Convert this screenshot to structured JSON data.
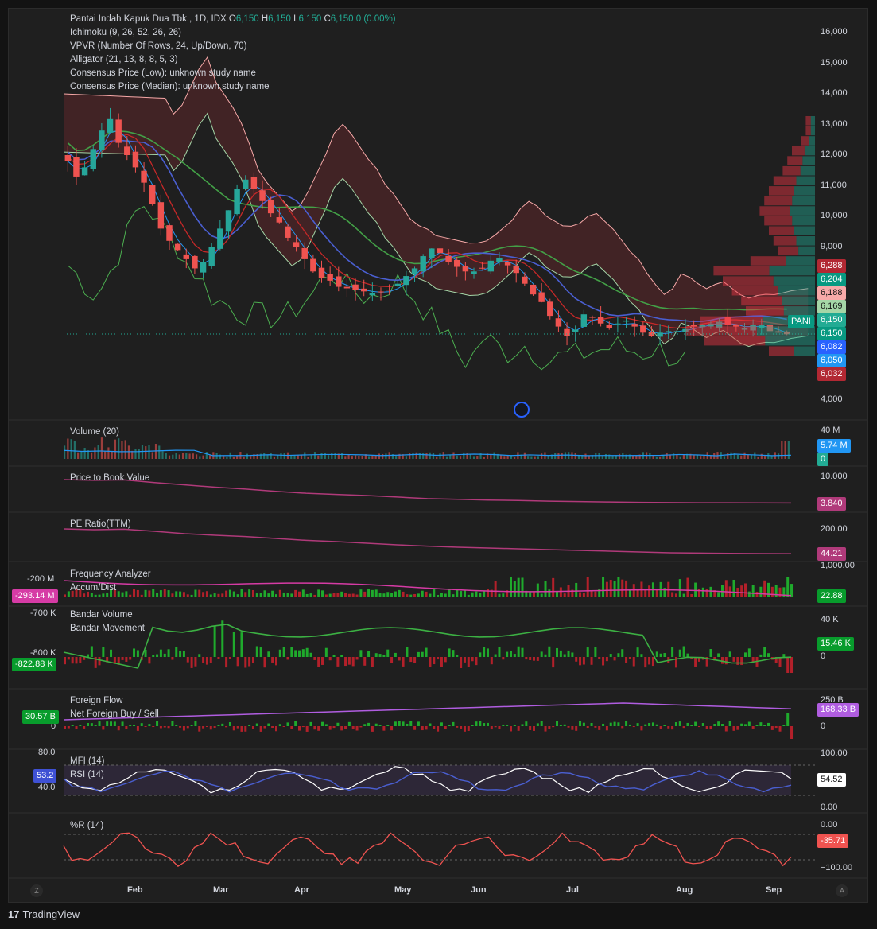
{
  "header": {
    "symbol_line": "Pantai Indah Kapuk Dua Tbk., 1D, IDX",
    "ohlc": [
      {
        "k": "O",
        "v": "6,150"
      },
      {
        "k": "H",
        "v": "6,150"
      },
      {
        "k": "L",
        "v": "6,150"
      },
      {
        "k": "C",
        "v": "6,150"
      }
    ],
    "change": "0 (0.00%)",
    "indicators": [
      "Ichimoku (9, 26, 52, 26, 26)",
      "VPVR (Number Of Rows, 24, Up/Down, 70)",
      "Alligator (21, 13, 8, 8, 5, 3)",
      "Consensus Price (Low): unknown study name",
      "Consensus Price (Median): unknown study name"
    ]
  },
  "chart_data": [
    {
      "type": "candlestick",
      "pane": "price",
      "symbol": "PANI",
      "y_ticks": [
        "16,000",
        "15,000",
        "14,000",
        "13,000",
        "12,000",
        "11,000",
        "10,000",
        "9,000",
        "4,000"
      ],
      "ylim": [
        4000,
        16500
      ],
      "close_series": [
        11800,
        11300,
        11600,
        12200,
        12800,
        13200,
        12400,
        12000,
        11600,
        11100,
        10400,
        9600,
        9200,
        8900,
        8600,
        8300,
        8500,
        9000,
        9600,
        10200,
        10900,
        11200,
        10900,
        10500,
        10100,
        9800,
        9300,
        9000,
        8600,
        8200,
        8000,
        7900,
        7700,
        7650,
        7600,
        7550,
        7500,
        7520,
        7600,
        7800,
        8050,
        8300,
        8700,
        8950,
        8800,
        8500,
        8350,
        8200,
        8200,
        8300,
        8550,
        8650,
        8400,
        8150,
        7800,
        7450,
        7200,
        6750,
        6400,
        6100,
        6300,
        6800,
        6700,
        6500,
        6350,
        6500,
        6600,
        6400,
        6200,
        6100,
        6200,
        6250,
        6250,
        6320,
        6400,
        6450,
        6500,
        6560,
        6450,
        6400,
        6350,
        6450,
        6450,
        6250,
        6200,
        6150
      ],
      "price_tags": [
        {
          "v": "6,288",
          "color": "#b22833"
        },
        {
          "v": "6,204",
          "color": "#089981"
        },
        {
          "v": "6,188",
          "color": "#f7a9a8"
        },
        {
          "v": "6,169",
          "color": "#a5d6a7"
        },
        {
          "v": "6,150",
          "color": "#22ab94"
        },
        {
          "v": "6,150",
          "color": "#089981"
        },
        {
          "v": "6,082",
          "color": "#2962ff"
        },
        {
          "v": "6,050",
          "color": "#2196f3"
        },
        {
          "v": "6,032",
          "color": "#b22833"
        }
      ],
      "ticker_tag": "PANI"
    },
    {
      "type": "bar",
      "pane": "volume",
      "label": "Volume (20)",
      "y_ticks": [
        "40 M"
      ],
      "tags": [
        {
          "v": "5.74 M",
          "color": "#2196f3"
        },
        {
          "v": "0",
          "color": "#22ab94"
        }
      ]
    },
    {
      "type": "line",
      "pane": "pbv",
      "label": "Price to Book Value",
      "y_ticks": [
        "10.000"
      ],
      "tags": [
        {
          "v": "3.840",
          "color": "#b03a7a"
        }
      ],
      "values": [
        10.0,
        9.8,
        9.9,
        9.2,
        8.6,
        8.0,
        7.5,
        6.9,
        6.4,
        6.1,
        5.8,
        5.4,
        5.0,
        4.8,
        4.6,
        4.5,
        4.3,
        4.2,
        4.1,
        4.0,
        3.95,
        3.9,
        3.88,
        3.86,
        3.84
      ]
    },
    {
      "type": "line",
      "pane": "pe",
      "label": "PE Ratio(TTM)",
      "y_ticks": [
        "200.00"
      ],
      "tags": [
        {
          "v": "44.21",
          "color": "#b03a7a"
        }
      ],
      "values": [
        200,
        195,
        198,
        185,
        170,
        160,
        152,
        140,
        128,
        120,
        110,
        100,
        92,
        85,
        80,
        75,
        70,
        65,
        60,
        55,
        50,
        48,
        46,
        45,
        44.21
      ]
    },
    {
      "type": "bar",
      "pane": "freq",
      "labels": [
        "Frequency Analyzer",
        "Accum/Dist"
      ],
      "y_ticks_left": [
        "-200 M"
      ],
      "y_ticks_right": [
        "1,000.00"
      ],
      "tags_left": [
        {
          "v": "-293.14 M",
          "color": "#d63ba5"
        }
      ],
      "tags": [
        {
          "v": "22.88",
          "color": "#089c2c"
        }
      ]
    },
    {
      "type": "bar",
      "pane": "bandar",
      "labels": [
        "Bandar Volume",
        "Bandar Movement"
      ],
      "y_ticks_left": [
        "-700 K",
        "-800 K"
      ],
      "y_ticks_right": [
        "40 K",
        "0"
      ],
      "tags_left": [
        {
          "v": "-822.88 K",
          "color": "#089c2c"
        }
      ],
      "tags": [
        {
          "v": "15.46 K",
          "color": "#089c2c"
        }
      ]
    },
    {
      "type": "bar",
      "pane": "foreign",
      "labels": [
        "Foreign Flow",
        "Net Foreign Buy / Sell"
      ],
      "y_ticks_left": [
        "0"
      ],
      "y_ticks_right": [
        "250 B",
        "0"
      ],
      "tags_left": [
        {
          "v": "30.57 B",
          "color": "#089c2c"
        }
      ],
      "tags": [
        {
          "v": "168.33 B",
          "color": "#b05de0"
        }
      ]
    },
    {
      "type": "line",
      "pane": "mfi_rsi",
      "labels": [
        "MFI (14)",
        "RSI (14)"
      ],
      "y_ticks_left": [
        "80.0",
        "40.0"
      ],
      "y_ticks_right": [
        "100.00",
        "0.00"
      ],
      "tags_left": [
        {
          "v": "53.2",
          "color": "#3f51d4"
        }
      ],
      "tags": [
        {
          "v": "54.52",
          "color": "#ffffff",
          "text": "#131313"
        }
      ]
    },
    {
      "type": "line",
      "pane": "williams",
      "label": "%R (14)",
      "y_ticks": [
        "0.00",
        "−100.00"
      ],
      "tags": [
        {
          "v": "-35.71",
          "color": "#f05350"
        }
      ]
    }
  ],
  "x_axis": {
    "months": [
      "Feb",
      "Mar",
      "Apr",
      "May",
      "Jun",
      "Jul",
      "Aug",
      "Sep"
    ]
  },
  "corner_left": "Z",
  "corner_right": "A",
  "brand": "TradingView"
}
